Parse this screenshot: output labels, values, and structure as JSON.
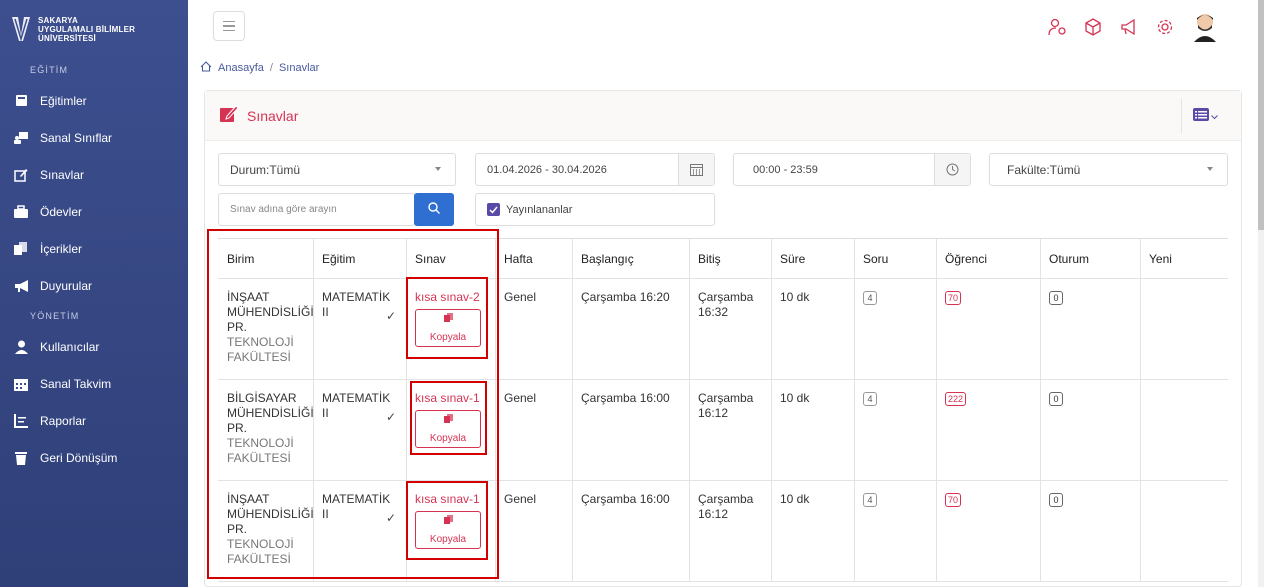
{
  "sidebar": {
    "logo": {
      "line1": "SAKARYA",
      "line2": "UYGULAMALI BİLİMLER",
      "line3": "ÜNİVERSİTESİ"
    },
    "section_education": "EĞİTİM",
    "section_admin": "YÖNETİM",
    "items": [
      {
        "label": "Eğitimler",
        "icon": "book-icon"
      },
      {
        "label": "Sanal Sınıflar",
        "icon": "classroom-icon"
      },
      {
        "label": "Sınavlar",
        "icon": "edit-icon"
      },
      {
        "label": "Ödevler",
        "icon": "briefcase-icon"
      },
      {
        "label": "İçerikler",
        "icon": "files-icon"
      },
      {
        "label": "Duyurular",
        "icon": "megaphone-icon"
      },
      {
        "label": "Kullanıcılar",
        "icon": "user-icon"
      },
      {
        "label": "Sanal Takvim",
        "icon": "calendar-icon"
      },
      {
        "label": "Raporlar",
        "icon": "report-icon"
      },
      {
        "label": "Geri Dönüşüm",
        "icon": "trash-icon"
      }
    ]
  },
  "breadcrumb": {
    "home": "Anasayfa",
    "current": "Sınavlar"
  },
  "card": {
    "title": "Sınavlar"
  },
  "filters": {
    "status": "Durum:Tümü",
    "date_range": "01.04.2026 - 30.04.2026",
    "time_range": "00:00 - 23:59",
    "faculty": "Fakülte:Tümü",
    "search_placeholder": "Sınav adına göre arayın",
    "published_label": "Yayınlananlar"
  },
  "table": {
    "headers": [
      "Birim",
      "Eğitim",
      "Sınav",
      "Hafta",
      "Başlangıç",
      "Bitiş",
      "Süre",
      "Soru",
      "Öğrenci",
      "Oturum",
      "Yeni"
    ],
    "copy_label": "Kopyala",
    "rows": [
      {
        "birim_l1": "İNŞAAT",
        "birim_l2": "MÜHENDİSLİĞİ",
        "birim_l3": "PR.",
        "faculty_l1": "TEKNOLOJİ",
        "faculty_l2": "FAKÜLTESİ",
        "egitim": "MATEMATİK II",
        "sinav": "kısa sınav-2",
        "hafta": "Genel",
        "baslangic": "Çarşamba 16:20",
        "bitis_l1": "Çarşamba",
        "bitis_l2": "16:32",
        "sure": "10 dk",
        "soru": "4",
        "ogrenci": "70",
        "oturum": "0"
      },
      {
        "birim_l1": "BİLGİSAYAR",
        "birim_l2": "MÜHENDİSLİĞİ",
        "birim_l3": "PR.",
        "faculty_l1": "TEKNOLOJİ",
        "faculty_l2": "FAKÜLTESİ",
        "egitim": "MATEMATİK II",
        "sinav": "kısa sınav-1",
        "hafta": "Genel",
        "baslangic": "Çarşamba 16:00",
        "bitis_l1": "Çarşamba",
        "bitis_l2": "16:12",
        "sure": "10 dk",
        "soru": "4",
        "ogrenci": "222",
        "oturum": "0"
      },
      {
        "birim_l1": "İNŞAAT",
        "birim_l2": "MÜHENDİSLİĞİ",
        "birim_l3": "PR.",
        "faculty_l1": "TEKNOLOJİ",
        "faculty_l2": "FAKÜLTESİ",
        "egitim": "MATEMATİK II",
        "sinav": "kısa sınav-1",
        "hafta": "Genel",
        "baslangic": "Çarşamba 16:00",
        "bitis_l1": "Çarşamba",
        "bitis_l2": "16:12",
        "sure": "10 dk",
        "soru": "4",
        "ogrenci": "70",
        "oturum": "0"
      }
    ]
  },
  "colors": {
    "sidebar": "#3d4f8f",
    "accent": "#d63353",
    "primary": "#2f6fd1",
    "annotation": "#d20000"
  }
}
